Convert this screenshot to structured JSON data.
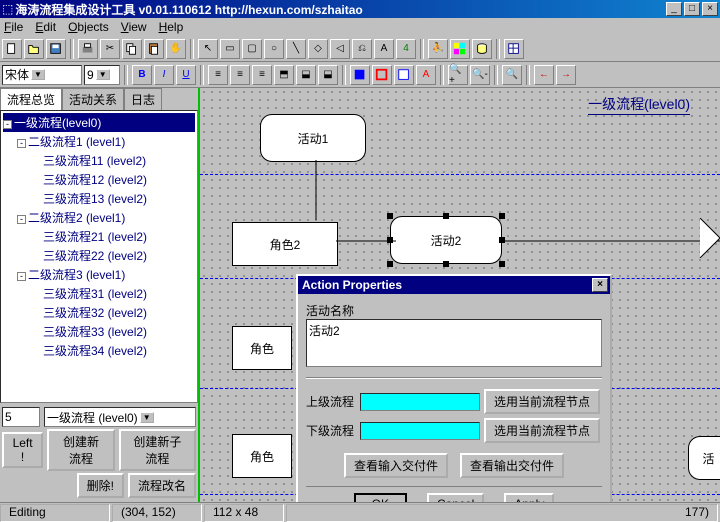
{
  "window": {
    "title": "海涛流程集成设计工具  v0.01.110612 http://hexun.com/szhaitao",
    "min": "_",
    "max": "□",
    "close": "×"
  },
  "menu": {
    "file": "File",
    "edit": "Edit",
    "objects": "Objects",
    "view": "View",
    "help": "Help"
  },
  "fmt": {
    "font": "宋体",
    "size": "9",
    "b": "B",
    "i": "I",
    "u": "U"
  },
  "sidebar": {
    "tabs": [
      "流程总览",
      "活动关系",
      "日志"
    ],
    "tree": {
      "root": "一级流程(level0)",
      "children": [
        {
          "label": "二级流程1 (level1)",
          "children": [
            "三级流程11 (level2)",
            "三级流程12 (level2)",
            "三级流程13 (level2)"
          ]
        },
        {
          "label": "二级流程2 (level1)",
          "children": [
            "三级流程21 (level2)",
            "三级流程22 (level2)"
          ]
        },
        {
          "label": "二级流程3 (level1)",
          "children": [
            "三级流程31 (level2)",
            "三级流程32 (level2)",
            "三级流程33 (level2)",
            "三级流程34 (level2)"
          ]
        }
      ]
    },
    "spin": "5",
    "level_combo": "一级流程 (level0)",
    "btn_left": "Left !",
    "btn_new_flow": "创建新流程",
    "btn_new_sub": "创建新子流程",
    "btn_del": "删除!",
    "btn_rename": "流程改名"
  },
  "canvas": {
    "title": "一级流程(level0)",
    "nodes": {
      "activity1": "活动1",
      "role2": "角色2",
      "activity2": "活动2",
      "role_partial": "角色",
      "role_partial2": "角色",
      "act_partial": "活"
    }
  },
  "dialog": {
    "title": "Action Properties",
    "lbl_name": "活动名称",
    "value_name": "活动2",
    "lbl_up": "上级流程",
    "lbl_down": "下级流程",
    "btn_select": "选用当前流程节点",
    "btn_in": "查看输入交付件",
    "btn_out": "查看输出交付件",
    "ok": "OK",
    "cancel": "Cancel",
    "apply": "Apply"
  },
  "status": {
    "mode": "Editing",
    "coords": "(304, 152)",
    "size": "112 x 48",
    "extra": "177)"
  }
}
